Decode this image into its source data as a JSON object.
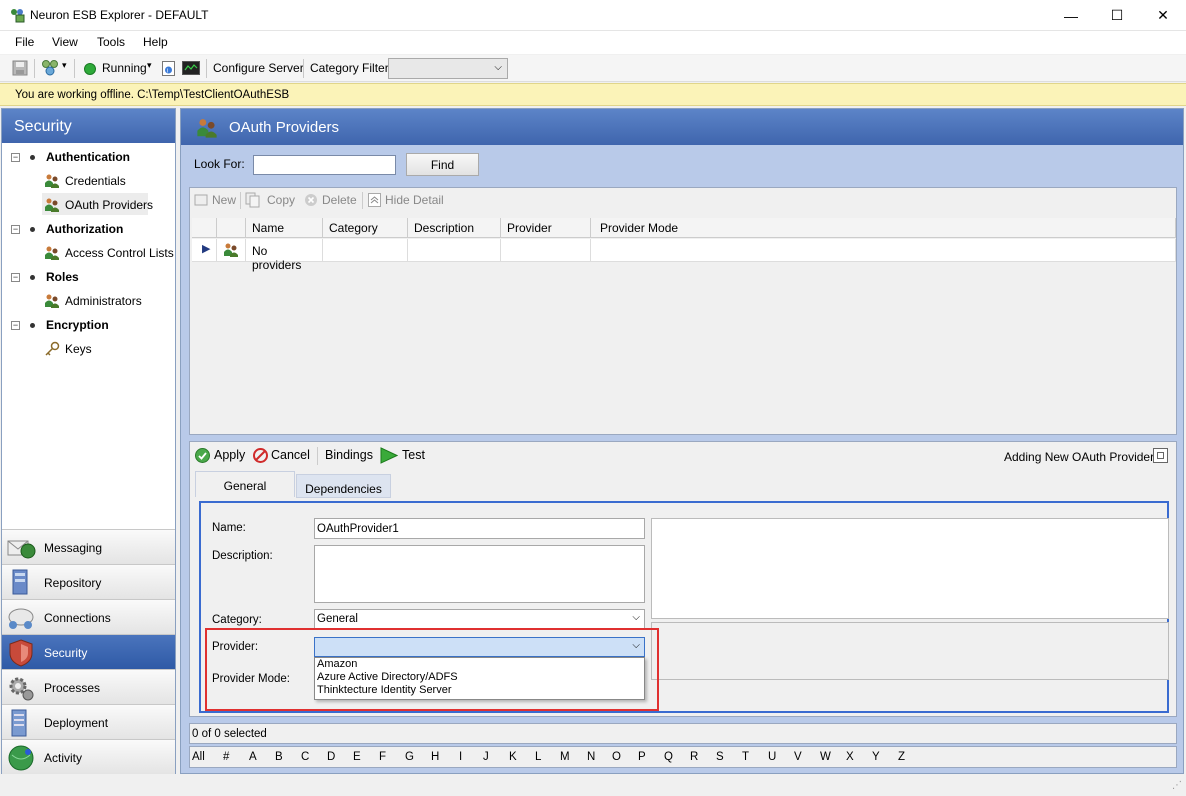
{
  "window": {
    "title": "Neuron ESB Explorer - DEFAULT",
    "minimize": "—",
    "maximize": "☐",
    "close": "✕"
  },
  "menu": {
    "file": "File",
    "view": "View",
    "tools": "Tools",
    "help": "Help"
  },
  "toolbar": {
    "running": "Running",
    "configure_server": "Configure Server",
    "category_filter": "Category Filter",
    "category_filter_value": ""
  },
  "offline_message": "You are working offline. C:\\Temp\\TestClientOAuthESB",
  "sidebar": {
    "header": "Security",
    "tree": [
      {
        "category": "Authentication",
        "items": [
          "Credentials",
          "OAuth Providers"
        ]
      },
      {
        "category": "Authorization",
        "items": [
          "Access Control Lists"
        ]
      },
      {
        "category": "Roles",
        "items": [
          "Administrators"
        ]
      },
      {
        "category": "Encryption",
        "items": [
          "Keys"
        ]
      }
    ],
    "selected_item": "OAuth Providers",
    "nav": [
      "Messaging",
      "Repository",
      "Connections",
      "Security",
      "Processes",
      "Deployment",
      "Activity"
    ],
    "active_nav": "Security"
  },
  "main": {
    "title": "OAuth Providers",
    "look_for_label": "Look For:",
    "look_for_value": "",
    "find_button": "Find",
    "grid_toolbar": {
      "new": "New",
      "copy": "Copy",
      "delete": "Delete",
      "hide_detail": "Hide Detail"
    },
    "columns": [
      "Name",
      "Category",
      "Description",
      "Provider",
      "Provider Mode"
    ],
    "rows": [
      {
        "name": "No providers",
        "category": "",
        "description": "",
        "provider": "",
        "provider_mode": ""
      }
    ],
    "detail_toolbar": {
      "apply": "Apply",
      "cancel": "Cancel",
      "bindings": "Bindings",
      "test": "Test",
      "status": "Adding New OAuth Provider"
    },
    "tabs": [
      "General",
      "Dependencies"
    ],
    "active_tab": "General",
    "form": {
      "name_label": "Name:",
      "name_value": "OAuthProvider1",
      "description_label": "Description:",
      "description_value": "",
      "category_label": "Category:",
      "category_value": "General",
      "provider_label": "Provider:",
      "provider_value": "",
      "provider_mode_label": "Provider Mode:",
      "provider_options": [
        "Amazon",
        "Azure Active Directory/ADFS",
        "Thinktecture Identity Server"
      ]
    },
    "selection_status": "0 of 0 selected",
    "alphabet": [
      "All",
      "#",
      "A",
      "B",
      "C",
      "D",
      "E",
      "F",
      "G",
      "H",
      "I",
      "J",
      "K",
      "L",
      "M",
      "N",
      "O",
      "P",
      "Q",
      "R",
      "S",
      "T",
      "U",
      "V",
      "W",
      "X",
      "Y",
      "Z"
    ]
  },
  "colors": {
    "header_blue": "#3f65ad",
    "highlight_red": "#e03030",
    "offline_bar": "#fbf3b8",
    "running_green": "#2eaa3a"
  }
}
